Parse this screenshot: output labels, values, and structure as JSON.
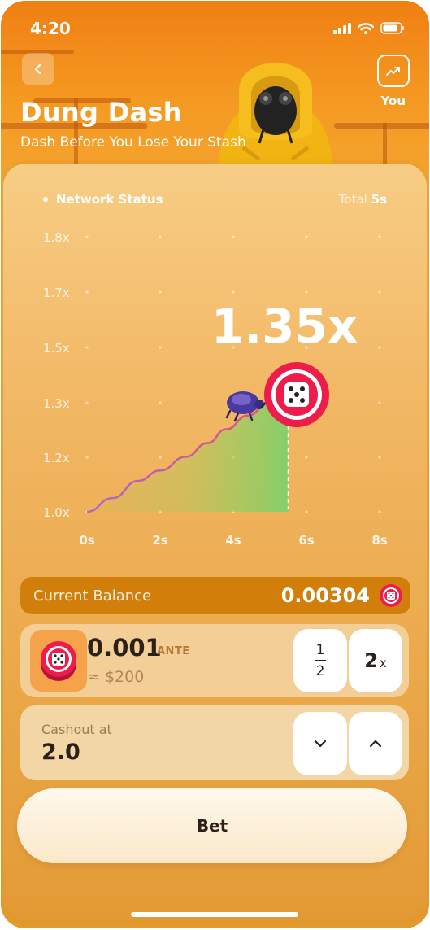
{
  "status_bar": {
    "time": "4:20"
  },
  "header": {
    "title": "Dung Dash",
    "subtitle": "Dash Before You Lose Your Stash",
    "you_label": "You"
  },
  "chart_panel": {
    "network_status": "Network Status",
    "total_label": "Total",
    "total_value": "5s",
    "multiplier": "1.35x"
  },
  "chart_data": {
    "type": "line",
    "xlabel": "",
    "ylabel": "",
    "x_ticks": [
      "0s",
      "2s",
      "4s",
      "6s",
      "8s"
    ],
    "y_ticks": [
      "1.8x",
      "1.7x",
      "1.5x",
      "1.3x",
      "1.2x",
      "1.0x"
    ],
    "xlim": [
      0,
      8
    ],
    "ylim": [
      1.0,
      1.8
    ],
    "series": [
      {
        "values_x": [
          0,
          0.7,
          1.4,
          2.0,
          2.7,
          3.3,
          3.8,
          4.4,
          5.0,
          5.5
        ],
        "values_y": [
          1.0,
          1.04,
          1.09,
          1.12,
          1.16,
          1.2,
          1.24,
          1.28,
          1.32,
          1.35
        ]
      }
    ],
    "colors": {
      "line_start": "#b067c8",
      "line_end": "#ee4a70",
      "fill_end": "#7fd06a"
    }
  },
  "balance": {
    "label": "Current Balance",
    "value": "0.00304"
  },
  "ante": {
    "amount": "0.001",
    "unit": "ANTE",
    "usd": "≈ $200",
    "half_num": "1",
    "half_den": "2",
    "double_label": "2",
    "double_suffix": "x"
  },
  "cashout": {
    "label": "Cashout at",
    "value": "2.0"
  },
  "bet_button": {
    "label": "Bet"
  }
}
